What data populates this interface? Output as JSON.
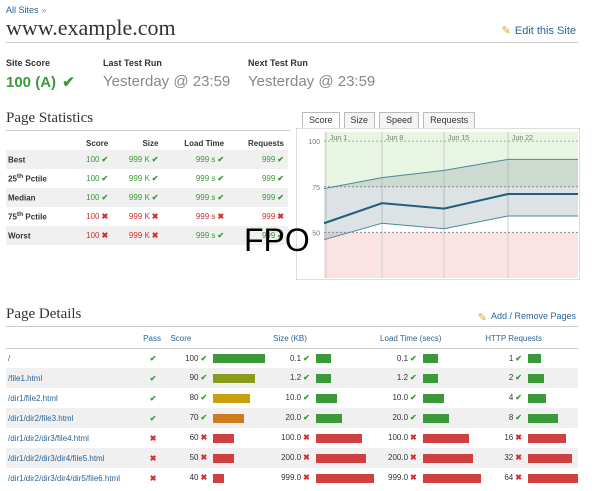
{
  "breadcrumb": {
    "label": "All Sites",
    "separator": "»"
  },
  "site": {
    "title": "www.example.com",
    "edit_label": "Edit this Site"
  },
  "meta": {
    "score_label": "Site Score",
    "score_value": "100 (A)",
    "last_label": "Last Test Run",
    "last_value": "Yesterday @ 23:59",
    "next_label": "Next Test Run",
    "next_value": "Yesterday @ 23:59"
  },
  "stats": {
    "title": "Page Statistics",
    "headers": [
      "Score",
      "Size",
      "Load Time",
      "Requests"
    ],
    "rows": [
      {
        "label": "Best",
        "sup": "",
        "suffix": "",
        "cells": [
          [
            "100",
            "ok"
          ],
          [
            "999 K",
            "ok"
          ],
          [
            "999 s",
            "ok"
          ],
          [
            "999",
            "ok"
          ]
        ]
      },
      {
        "label": "25",
        "sup": "th",
        "suffix": " Pctile",
        "cells": [
          [
            "100",
            "ok"
          ],
          [
            "999 K",
            "ok"
          ],
          [
            "999 s",
            "ok"
          ],
          [
            "999",
            "ok"
          ]
        ]
      },
      {
        "label": "Median",
        "sup": "",
        "suffix": "",
        "cells": [
          [
            "100",
            "ok"
          ],
          [
            "999 K",
            "ok"
          ],
          [
            "999 s",
            "ok"
          ],
          [
            "999",
            "ok"
          ]
        ]
      },
      {
        "label": "75",
        "sup": "th",
        "suffix": " Pctile",
        "cells": [
          [
            "100",
            "bad"
          ],
          [
            "999 K",
            "bad"
          ],
          [
            "999 s",
            "bad"
          ],
          [
            "999",
            "bad"
          ]
        ]
      },
      {
        "label": "Worst",
        "sup": "",
        "suffix": "",
        "cells": [
          [
            "100",
            "bad"
          ],
          [
            "999 K",
            "bad"
          ],
          [
            "999 s",
            "ok"
          ],
          [
            "999",
            "ok"
          ]
        ]
      }
    ]
  },
  "tabs": [
    "Score",
    "Size",
    "Speed",
    "Requests"
  ],
  "chart_data": {
    "type": "area",
    "x": [
      "Jun 1",
      "Jun 8",
      "Jun 15",
      "Jun 22"
    ],
    "ylim": [
      0,
      100
    ],
    "yticks": [
      50,
      75,
      100
    ],
    "grid": true,
    "series": [
      {
        "values": [
          74,
          80,
          84,
          90,
          90
        ]
      },
      {
        "values": [
          55,
          66,
          63,
          71,
          71
        ]
      },
      {
        "values": [
          46,
          55,
          52,
          59,
          59
        ]
      }
    ],
    "bands": {
      "good_above": 75,
      "bad_below": 50
    }
  },
  "fpo": "FPO",
  "details": {
    "title": "Page Details",
    "add_label": "Add / Remove Pages",
    "headers": [
      "Pass",
      "Score",
      "Size (KB)",
      "Load Time (secs)",
      "HTTP Requests"
    ],
    "rows": [
      {
        "path": "/",
        "pass": "ok",
        "score": "100",
        "score_state": "ok",
        "score_color": "#3a9a3a",
        "score_frac": 1.0,
        "size": "0.1",
        "size_state": "ok",
        "size_frac": 0.25,
        "load": "0.1",
        "load_state": "ok",
        "load_frac": 0.25,
        "req": "1",
        "req_state": "ok",
        "req_frac": 0.25
      },
      {
        "path": "/file1.html",
        "pass": "ok",
        "score": "90",
        "score_state": "ok",
        "score_color": "#8a9a1a",
        "score_frac": 0.81,
        "size": "1.2",
        "size_state": "ok",
        "size_frac": 0.25,
        "load": "1.2",
        "load_state": "ok",
        "load_frac": 0.25,
        "req": "2",
        "req_state": "ok",
        "req_frac": 0.31
      },
      {
        "path": "/dir1/file2.html",
        "pass": "ok",
        "score": "80",
        "score_state": "ok",
        "score_color": "#c8a010",
        "score_frac": 0.71,
        "size": "10.0",
        "size_state": "ok",
        "size_frac": 0.37,
        "load": "10.0",
        "load_state": "ok",
        "load_frac": 0.37,
        "req": "4",
        "req_state": "ok",
        "req_frac": 0.35
      },
      {
        "path": "/dir1/dir2/file3.html",
        "pass": "ok",
        "score": "70",
        "score_state": "ok",
        "score_color": "#d07a20",
        "score_frac": 0.6,
        "size": "20.0",
        "size_state": "ok",
        "size_frac": 0.45,
        "load": "20.0",
        "load_state": "ok",
        "load_frac": 0.45,
        "req": "8",
        "req_state": "ok",
        "req_frac": 0.6
      },
      {
        "path": "/dir1/dir2/dir3/file4.html",
        "pass": "bad",
        "score": "60",
        "score_state": "bad",
        "score_color": "#d04040",
        "score_frac": 0.4,
        "size": "100.0",
        "size_state": "bad",
        "size_frac": 0.8,
        "load": "100.0",
        "load_state": "bad",
        "load_frac": 0.8,
        "req": "16",
        "req_state": "bad",
        "req_frac": 0.76
      },
      {
        "path": "/dir1/dir2/dir3/dir4/file5.html",
        "pass": "bad",
        "score": "50",
        "score_state": "bad",
        "score_color": "#d04040",
        "score_frac": 0.4,
        "size": "200.0",
        "size_state": "bad",
        "size_frac": 0.87,
        "load": "200.0",
        "load_state": "bad",
        "load_frac": 0.87,
        "req": "32",
        "req_state": "bad",
        "req_frac": 0.88
      },
      {
        "path": "/dir1/dir2/dir3/dir4/dir5/file6.html",
        "pass": "bad",
        "score": "40",
        "score_state": "bad",
        "score_color": "#d04040",
        "score_frac": 0.22,
        "size": "999.0",
        "size_state": "bad",
        "size_frac": 1.0,
        "load": "999.0",
        "load_state": "bad",
        "load_frac": 1.0,
        "req": "64",
        "req_state": "bad",
        "req_frac": 1.0
      }
    ]
  },
  "colors": {
    "good": "#3a9a3a",
    "bad": "#d04040",
    "link": "#2a6496"
  },
  "icons": {
    "ok": "check-icon",
    "bad": "x-icon",
    "edit": "pencil-icon"
  }
}
